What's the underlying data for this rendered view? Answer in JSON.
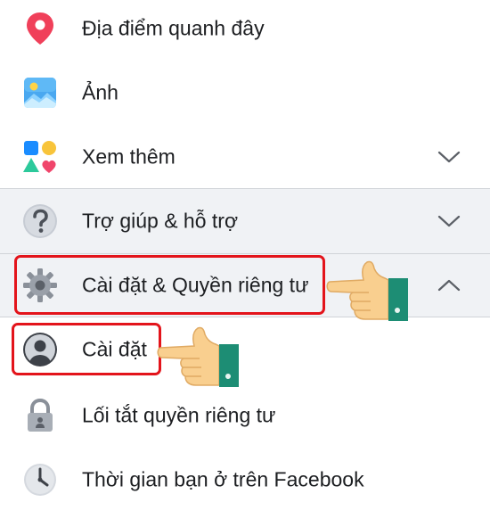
{
  "menu": {
    "items": [
      {
        "label": "Địa điểm quanh đây",
        "icon": "location-pin-icon"
      },
      {
        "label": "Ảnh",
        "icon": "photos-icon"
      },
      {
        "label": "Xem thêm",
        "icon": "shapes-icon",
        "expanded": false
      },
      {
        "label": "Trợ giúp & hỗ trợ",
        "icon": "help-icon",
        "expanded": false
      },
      {
        "label": "Cài đặt & Quyền riêng tư",
        "icon": "gear-icon",
        "expanded": true
      },
      {
        "label": "Cài đặt",
        "icon": "user-avatar-icon"
      },
      {
        "label": "Lối tắt quyền riêng tư",
        "icon": "lock-icon"
      },
      {
        "label": "Thời gian bạn ở trên Facebook",
        "icon": "clock-icon"
      }
    ]
  },
  "colors": {
    "highlight": "#e3141b",
    "section_bg": "#f0f2f5",
    "text": "#1c1e21",
    "pin": "#f0405a",
    "hand_skin": "#f9cf8f",
    "hand_cuff": "#1d8d74"
  }
}
